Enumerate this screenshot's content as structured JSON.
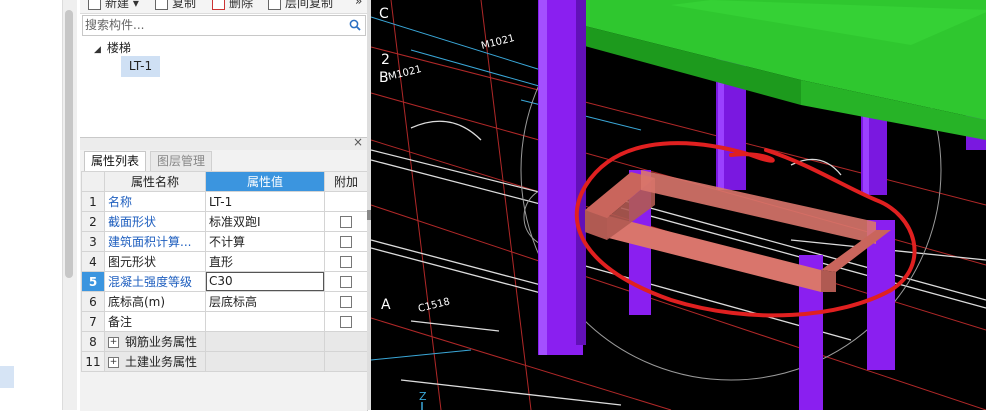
{
  "toolbar": {
    "new_label": "新建",
    "copy_label": "复制",
    "delete_label": "删除",
    "floor_copy_label": "层间复制",
    "more_icon": "double-chevron-right-icon"
  },
  "search": {
    "placeholder": "搜索构件..."
  },
  "tree": {
    "root_label": "楼梯",
    "child_label": "LT-1"
  },
  "property_panel": {
    "tabs": [
      "属性列表",
      "图层管理"
    ],
    "close_icon": "close-icon",
    "columns": [
      "属性名称",
      "属性值",
      "附加"
    ],
    "rows": [
      {
        "num": "1",
        "name": "名称",
        "value": "LT-1"
      },
      {
        "num": "2",
        "name": "截面形状",
        "value": "标准双跑I"
      },
      {
        "num": "3",
        "name": "建筑面积计算...",
        "value": "不计算"
      },
      {
        "num": "4",
        "name": "图元形状",
        "value": "直形"
      },
      {
        "num": "5",
        "name": "混凝土强度等级",
        "value": "C30"
      },
      {
        "num": "6",
        "name": "底标高(m)",
        "value": "层底标高"
      },
      {
        "num": "7",
        "name": "备注",
        "value": ""
      },
      {
        "num": "8",
        "name": "钢筋业务属性",
        "value": ""
      },
      {
        "num": "11",
        "name": "土建业务属性",
        "value": ""
      }
    ],
    "accent_color": "#3b95df"
  },
  "viewport": {
    "axis_labels": [
      "C",
      "2",
      "B",
      "A"
    ],
    "door_labels": [
      "M1021",
      "M1021",
      "C1518"
    ],
    "z_label": "Z",
    "colors": {
      "beam": "#33cc33",
      "column": "#8a1ff0",
      "stair": "#d9756c",
      "markup": "#e02020",
      "grid_line": "#c03030"
    }
  }
}
